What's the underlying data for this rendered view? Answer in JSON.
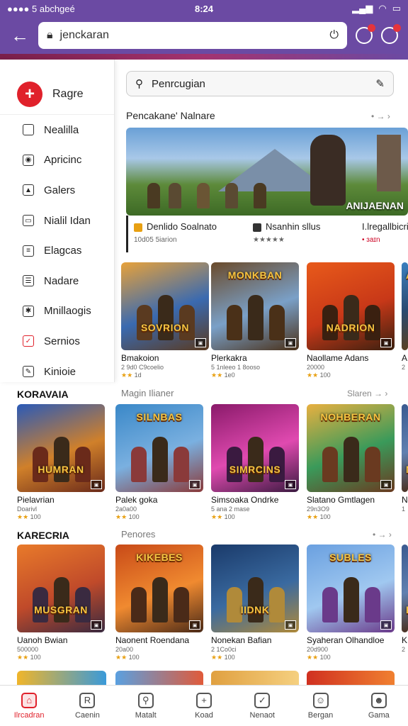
{
  "status": {
    "carrier": "●●●● 5 abchgeé",
    "time": "8:24",
    "icons": [
      "signal-icon",
      "wifi-icon",
      "battery-icon"
    ]
  },
  "browser": {
    "url": "jenckaran",
    "back_icon": "arrow-left-icon"
  },
  "sidebar": {
    "primary": {
      "label": "Ragre"
    },
    "items": [
      {
        "label": "Nealilla",
        "icon": "square-icon"
      },
      {
        "label": "Apricinc",
        "icon": "gamepad-icon"
      },
      {
        "label": "Galers",
        "icon": "bell-icon"
      },
      {
        "label": "Nialil Idan",
        "icon": "folder-icon"
      },
      {
        "label": "Elagcas",
        "icon": "document-icon"
      },
      {
        "label": "Nadare",
        "icon": "list-icon"
      },
      {
        "label": "Mnillaogis",
        "icon": "gear-icon"
      },
      {
        "label": "Sernios",
        "icon": "checkbox-icon"
      },
      {
        "label": "Kinioie",
        "icon": "edit-icon"
      }
    ]
  },
  "search": {
    "placeholder": "Penrcugian"
  },
  "featured": {
    "title": "Pencakane' Nalnare",
    "more": "• → ›",
    "hero_tag": "ANIJAENAN",
    "info": [
      {
        "name": "Denlido Soalnato",
        "sub": "10d05 5iarion",
        "stars": ""
      },
      {
        "name": "Nsanhin sllus",
        "sub": "",
        "stars": "★★★★★"
      },
      {
        "name": "I.lregallbicri",
        "sub": "• ɜaɪn",
        "stars": ""
      }
    ]
  },
  "row1": [
    {
      "logo": "SOVRION",
      "name": "Bmakoion",
      "sub": "2 9d0 C9coelio",
      "rate": "1d"
    },
    {
      "logo": "MONKBAN",
      "name": "Plerkakra",
      "sub": "5 1nleeo 1 8ooso",
      "rate": "1e0"
    },
    {
      "logo": "NADRION",
      "name": "Naollame Adans",
      "sub": "20000",
      "rate": "100"
    },
    {
      "logo": "A",
      "name": "A",
      "sub": "2",
      "rate": ""
    }
  ],
  "section2": {
    "title": "Magin Ilianer",
    "more": "Slaren → ›"
  },
  "left_sec1": "KORAVAIA",
  "row2": [
    {
      "logo": "HUMRAN",
      "name": "Pielavrian",
      "sub": "Doarivl",
      "rate": "100"
    },
    {
      "logo": "SILNBAS",
      "name": "Palek goka",
      "sub": "2a0a00",
      "rate": "100"
    },
    {
      "logo": "SIMRCINS",
      "name": "Simsoaka Ondrke",
      "sub": "5 ana 2 mase",
      "rate": "100"
    },
    {
      "logo": "NOHBERAN",
      "name": "Slatano Gmtlagen",
      "sub": "29n3O9",
      "rate": "100"
    },
    {
      "logo": "N",
      "name": "N",
      "sub": "1",
      "rate": ""
    }
  ],
  "section3": {
    "title": "Penores",
    "more": "• → ›"
  },
  "left_sec2": "KARECRIA",
  "row3": [
    {
      "logo": "MUSGRAN",
      "name": "Uanoh Bwian",
      "sub": "500000",
      "rate": "100"
    },
    {
      "logo": "KIKEBES",
      "name": "Naonent Roendana",
      "sub": "20a00",
      "rate": "100"
    },
    {
      "logo": "IIDNK",
      "name": "Nonekan Bafian",
      "sub": "2 1Co0ci",
      "rate": "100"
    },
    {
      "logo": "SUBLES",
      "name": "Syaheran Olhandloe",
      "sub": "20d900",
      "rate": "100"
    },
    {
      "logo": "K",
      "name": "K",
      "sub": "2",
      "rate": ""
    }
  ],
  "bottom_nav": [
    {
      "label": "Ilrcadran",
      "icon": "home-icon",
      "active": true
    },
    {
      "label": "Caenin",
      "icon": "grid-icon",
      "active": false
    },
    {
      "label": "Matalt",
      "icon": "search-icon",
      "active": false
    },
    {
      "label": "Koad",
      "icon": "plus-box-icon",
      "active": false
    },
    {
      "label": "Nenaot",
      "icon": "heart-icon",
      "active": false
    },
    {
      "label": "Bergan",
      "icon": "user-icon",
      "active": false
    },
    {
      "label": "Gama",
      "icon": "profile-icon",
      "active": false
    }
  ]
}
